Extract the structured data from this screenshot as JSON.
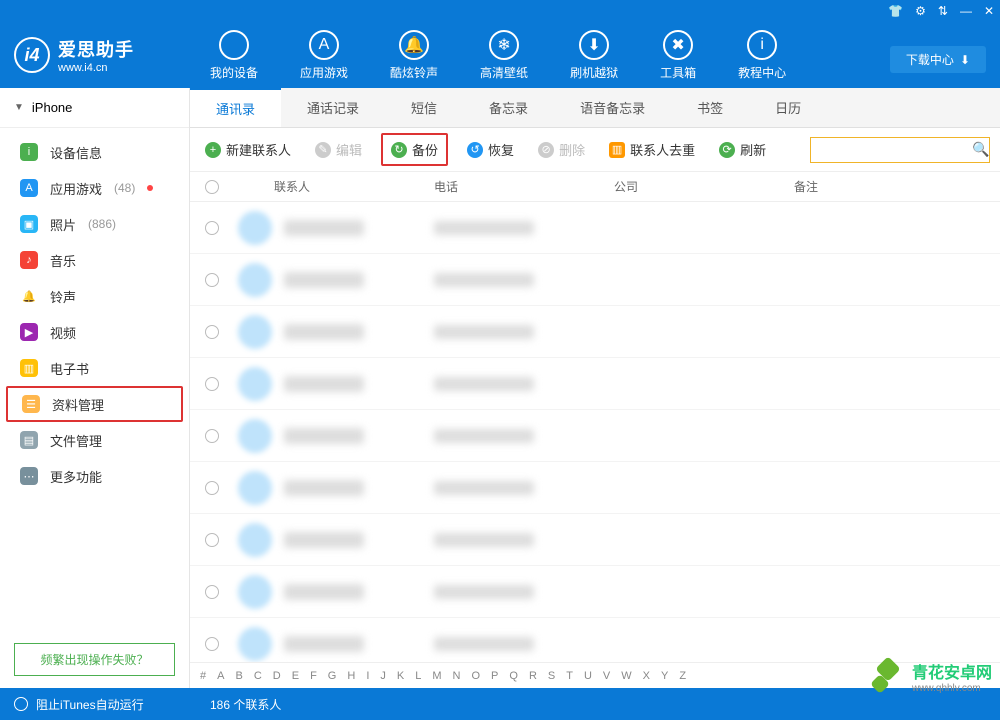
{
  "app": {
    "name_cn": "爱思助手",
    "name_en": "www.i4.cn"
  },
  "window_controls": [
    "👕",
    "⚙",
    "⇅",
    "—",
    "✕"
  ],
  "topnav": [
    {
      "label": "我的设备",
      "icon": "",
      "name": "my-device"
    },
    {
      "label": "应用游戏",
      "icon": "A",
      "name": "apps-games"
    },
    {
      "label": "酷炫铃声",
      "icon": "🔔",
      "name": "ringtones"
    },
    {
      "label": "高清壁纸",
      "icon": "❄",
      "name": "wallpapers"
    },
    {
      "label": "刷机越狱",
      "icon": "⬇",
      "name": "jailbreak"
    },
    {
      "label": "工具箱",
      "icon": "✖",
      "name": "toolbox"
    },
    {
      "label": "教程中心",
      "icon": "i",
      "name": "tutorials"
    }
  ],
  "download_center": "下载中心",
  "device_selector": "iPhone",
  "sidebar": [
    {
      "label": "设备信息",
      "icon": "i",
      "color": "#4caf50",
      "name": "device-info"
    },
    {
      "label": "应用游戏",
      "icon": "A",
      "color": "#2196f3",
      "badge": "(48)",
      "dot": true,
      "name": "apps"
    },
    {
      "label": "照片",
      "icon": "▣",
      "color": "#29b6f6",
      "badge": "(886)",
      "name": "photos"
    },
    {
      "label": "音乐",
      "icon": "♪",
      "color": "#f44336",
      "name": "music"
    },
    {
      "label": "铃声",
      "icon": "🔔",
      "color": "#ff9800",
      "plain": true,
      "name": "ringtones"
    },
    {
      "label": "视频",
      "icon": "▶",
      "color": "#9c27b0",
      "name": "videos"
    },
    {
      "label": "电子书",
      "icon": "▥",
      "color": "#ffc107",
      "name": "ebooks"
    },
    {
      "label": "资料管理",
      "icon": "☰",
      "color": "#ffb74d",
      "name": "data-manage",
      "highlighted": true
    },
    {
      "label": "文件管理",
      "icon": "▤",
      "color": "#90a4ae",
      "name": "files"
    },
    {
      "label": "更多功能",
      "icon": "⋯",
      "color": "#78909c",
      "name": "more"
    }
  ],
  "help_link": "频繁出现操作失败？",
  "tabs": [
    "通讯录",
    "通话记录",
    "短信",
    "备忘录",
    "语音备忘录",
    "书签",
    "日历"
  ],
  "active_tab": 0,
  "toolbar": {
    "new": "新建联系人",
    "edit": "编辑",
    "backup": "备份",
    "restore": "恢复",
    "delete": "删除",
    "dedup": "联系人去重",
    "refresh": "刷新"
  },
  "columns": [
    "联系人",
    "电话",
    "公司",
    "备注"
  ],
  "row_count": 9,
  "alpha": [
    "#",
    "A",
    "B",
    "C",
    "D",
    "E",
    "F",
    "G",
    "H",
    "I",
    "J",
    "K",
    "L",
    "M",
    "N",
    "O",
    "P",
    "Q",
    "R",
    "S",
    "T",
    "U",
    "V",
    "W",
    "X",
    "Y",
    "Z"
  ],
  "status": {
    "itunes": "阻止iTunes自动运行",
    "count": "186 个联系人"
  },
  "watermark": {
    "l1": "青花安卓网",
    "l2": "www.qhhlv.com"
  }
}
